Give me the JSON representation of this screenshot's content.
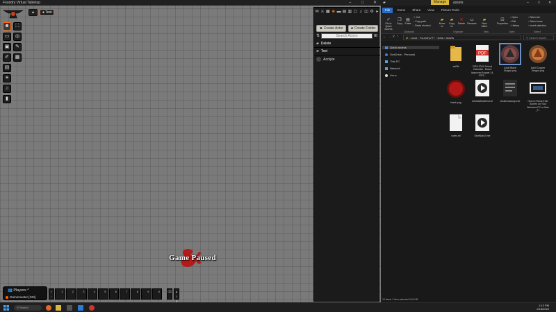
{
  "foundry": {
    "window_title": "Foundry Virtual Tabletop",
    "scene_tab": "Test",
    "paused_text": "Game Paused",
    "players_title": "Players",
    "players_user": "Gamemaster [GM]",
    "hotbar_slots": [
      "1",
      "2",
      "3",
      "4",
      "5",
      "6",
      "7",
      "8",
      "9",
      "0"
    ],
    "hotbar_page": "1"
  },
  "sidebar": {
    "create_actor": "Create Actor",
    "create_folder": "Create Folder",
    "search_placeholder": "Search Actors",
    "folders": [
      "Delete",
      "Test"
    ],
    "actor_name": "Acolyte"
  },
  "explorer": {
    "title": "assets",
    "manage_tab": "Manage",
    "tabs": [
      "File",
      "Home",
      "Share",
      "View",
      "Picture Tools"
    ],
    "ribbon": {
      "pin": "Pin to Quick access",
      "copy": "Copy",
      "paste": "Paste",
      "cut": "Cut",
      "copy_path": "Copy path",
      "paste_shortcut": "Paste shortcut",
      "move_to": "Move to",
      "copy_to": "Copy to",
      "delete": "Delete",
      "rename": "Rename",
      "new_folder": "New folder",
      "properties": "Properties",
      "open": "Open",
      "edit": "Edit",
      "history": "History",
      "select_all": "Select all",
      "select_none": "Select none",
      "invert_selection": "Invert selection",
      "groups": [
        "Clipboard",
        "Organize",
        "New",
        "Open",
        "Select"
      ]
    },
    "path": [
      "Local",
      "FoundryVTT",
      "Data",
      "assets"
    ],
    "search_placeholder": "Search assets",
    "nav": [
      "Quick access",
      "OneDrive - Personal",
      "This PC",
      "Network",
      "Linux"
    ],
    "files": [
      {
        "name": "anElk"
      },
      {
        "name": "2023-2024 School Calendar - Board Approved August 14, 2023..."
      },
      {
        "name": "Adult Black Dragon.png"
      },
      {
        "name": "Adult Copper Dragon.png"
      },
      {
        "name": "blank.png"
      },
      {
        "name": "CentralAreaExt.exe"
      },
      {
        "name": "create-backup.exe"
      },
      {
        "name": "How to Record the Screen on Your Windows PC or Mac _F..."
      },
      {
        "name": "notes.txt"
      },
      {
        "name": "StarWars2.exe"
      }
    ],
    "status": "10 items   1 item selected  3.60 KB"
  },
  "taskbar": {
    "search": "Search",
    "time": "1:13 PM",
    "date": "2/18/2024"
  }
}
